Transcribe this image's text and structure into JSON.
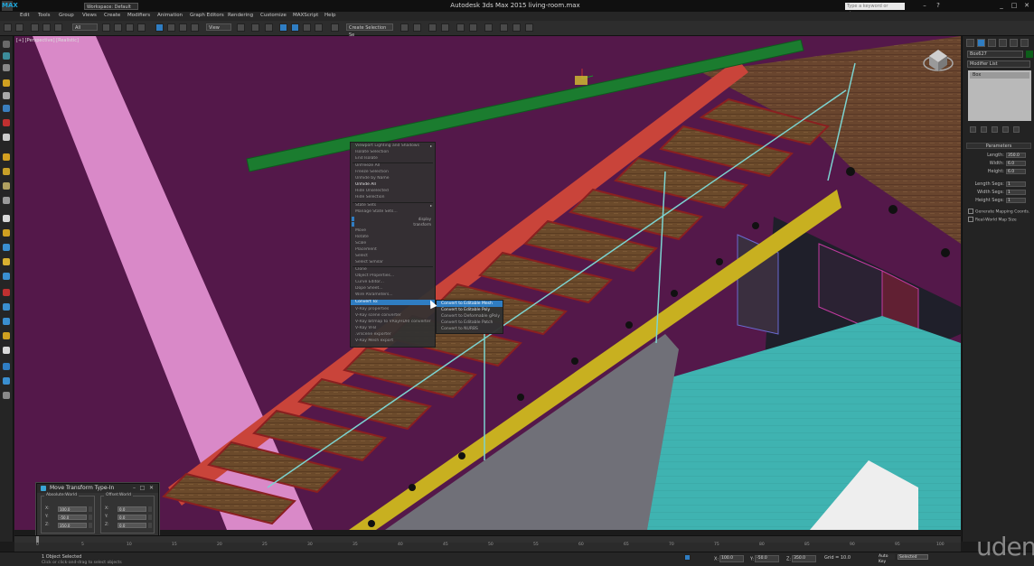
{
  "window": {
    "title": "Autodesk 3ds Max 2015     living-room.max",
    "workspace": "Workspace: Default",
    "search_placeholder": "Type a keyword or phrase",
    "logo": "MAX"
  },
  "menu": [
    "Edit",
    "Tools",
    "Group",
    "Views",
    "Create",
    "Modifiers",
    "Animation",
    "Graph Editors",
    "Rendering",
    "Customize",
    "MAXScript",
    "Help"
  ],
  "toolbar": {
    "selection_filter": "All",
    "reference_coord": "View",
    "named_selection": "Create Selection Se"
  },
  "viewport": {
    "label": "[+] [Perspective] [Realistic]"
  },
  "quad_menu": {
    "items": [
      "Viewport Lighting and Shadows",
      "Isolate Selection",
      "End Isolate",
      "Unfreeze All",
      "Freeze Selection",
      "Unhide by Name",
      "Unhide All",
      "Hide Unselected",
      "Hide Selection",
      "State Sets",
      "Manage State Sets...",
      "Move",
      "Rotate",
      "Scale",
      "Placement",
      "Select",
      "Select Similar",
      "Clone",
      "Object Properties...",
      "Curve Editor...",
      "Dope Sheet...",
      "Wire Parameters...",
      "Convert To:",
      "V-Ray properties",
      "V-Ray scene converter",
      "V-Ray bitmap to VRayHDRI converter",
      "V-Ray VFB",
      ".vrscene exporter",
      "V-Ray Mesh export"
    ],
    "labels_small": {
      "display": "display",
      "transform": "transform"
    }
  },
  "convert_submenu": [
    "Convert to Editable Mesh",
    "Convert to Editable Poly",
    "Convert to Deformable gPoly",
    "Convert to Editable Patch",
    "Convert to NURBS"
  ],
  "command_panel": {
    "object_name": "Box627",
    "modifier_list": "Modifier List",
    "stack_item": "Box",
    "params_title": "Parameters",
    "params": [
      {
        "label": "Length:",
        "value": "350.0"
      },
      {
        "label": "Width:",
        "value": "6.0"
      },
      {
        "label": "Height:",
        "value": "6.0"
      },
      {
        "label": "Length Segs:",
        "value": "1"
      },
      {
        "label": "Width Segs:",
        "value": "1"
      },
      {
        "label": "Height Segs:",
        "value": "1"
      }
    ],
    "checks": [
      "Generate Mapping Coords.",
      "Real-World Map Size"
    ]
  },
  "move_typein": {
    "title": "Move Transform Type-In",
    "absolute": {
      "title": "Absolute:World",
      "rows": [
        {
          "axis": "X:",
          "value": "100.0"
        },
        {
          "axis": "Y:",
          "value": "-50.0"
        },
        {
          "axis": "Z:",
          "value": "350.0"
        }
      ]
    },
    "offset": {
      "title": "Offset:World",
      "rows": [
        {
          "axis": "X:",
          "value": "0.0"
        },
        {
          "axis": "Y:",
          "value": "0.0"
        },
        {
          "axis": "Z:",
          "value": "0.0"
        }
      ]
    }
  },
  "timeline": {
    "position": "0 / 100",
    "ticks": [
      "0",
      "5",
      "10",
      "15",
      "20",
      "25",
      "30",
      "35",
      "40",
      "45",
      "50",
      "55",
      "60",
      "65",
      "70",
      "75",
      "80",
      "85",
      "90",
      "95",
      "100"
    ]
  },
  "status": {
    "selected": "1 Object Selected",
    "prompt": "Click or click-and-drag to select objects",
    "x": "100.0",
    "y": "-50.0",
    "z": "350.0",
    "grid": "Grid = 10.0",
    "autokey": "Auto Key",
    "setkey": "Selected"
  },
  "watermark": "udemy",
  "colors": {
    "accent": "#2f7dc2",
    "viewport_bg": "#591a4e"
  }
}
